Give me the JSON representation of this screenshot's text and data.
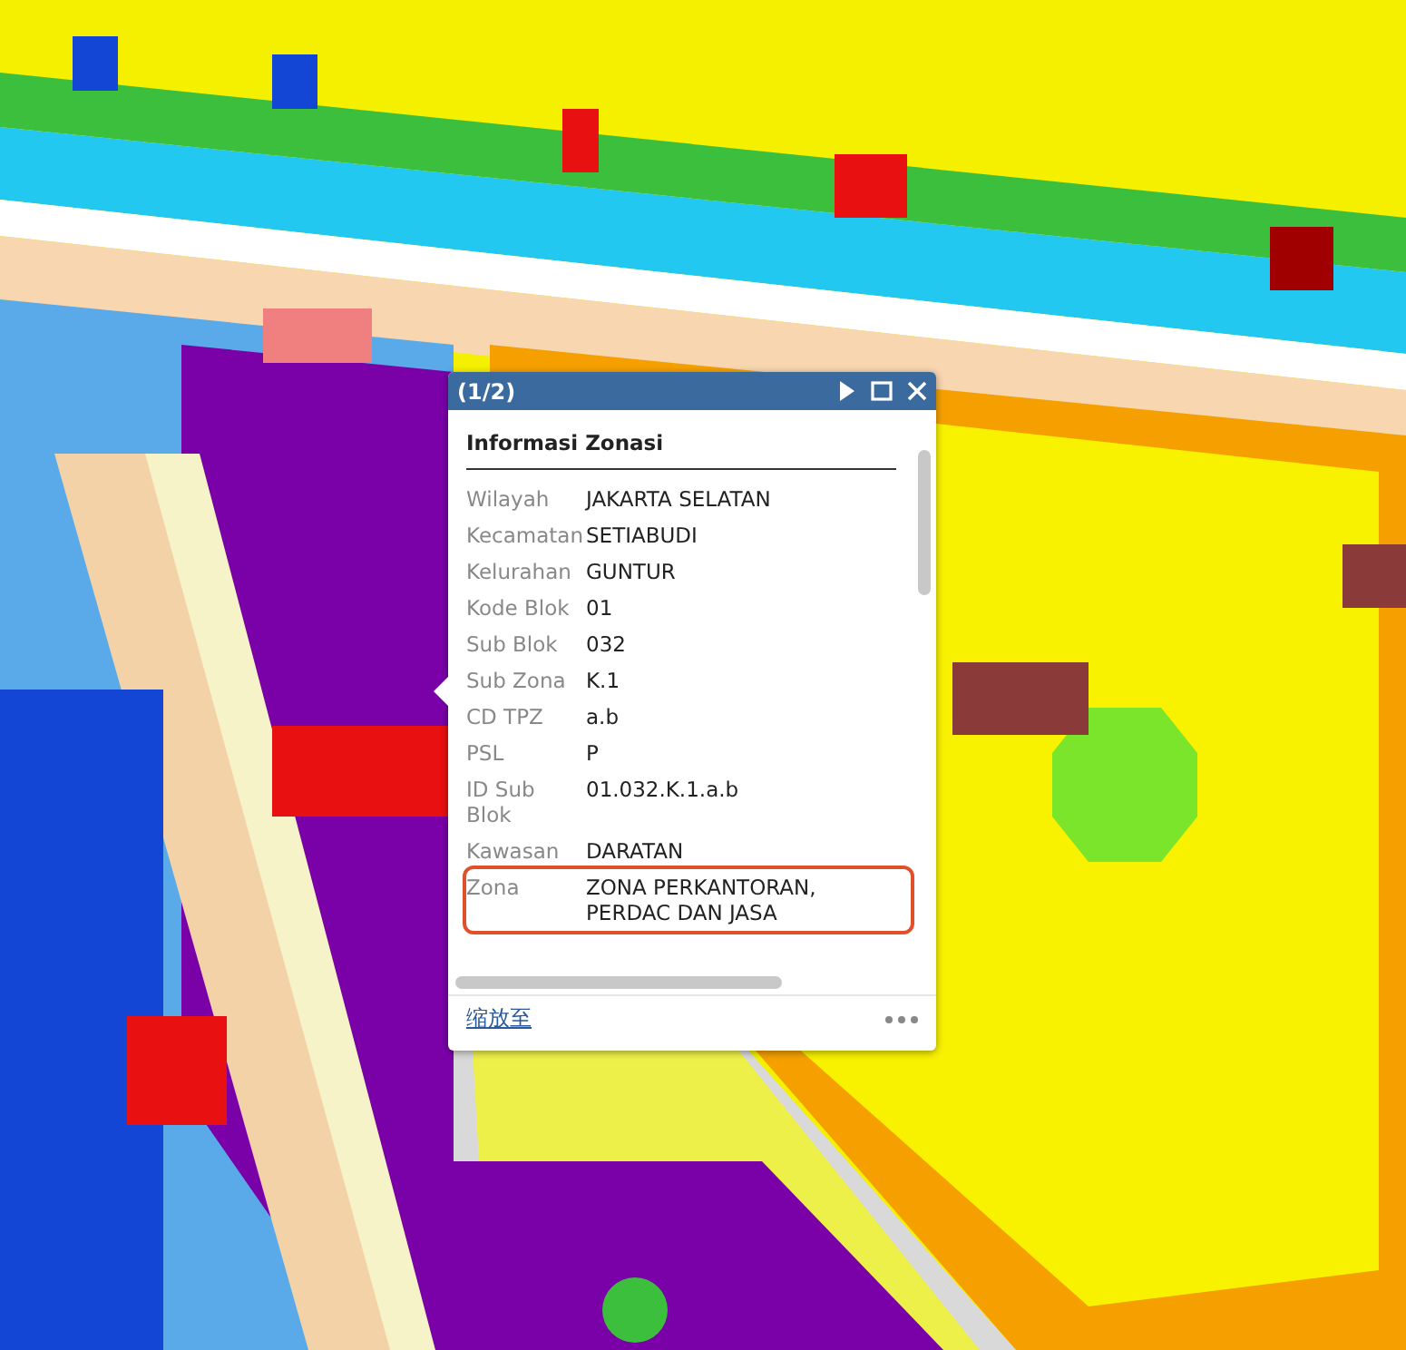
{
  "popup": {
    "counter": "(1/2)",
    "title": "Informasi Zonasi",
    "rows": [
      {
        "label": "Wilayah",
        "value": "JAKARTA SELATAN",
        "highlighted": false
      },
      {
        "label": "Kecamatan",
        "value": "SETIABUDI",
        "highlighted": false
      },
      {
        "label": "Kelurahan",
        "value": "GUNTUR",
        "highlighted": false
      },
      {
        "label": "Kode Blok",
        "value": "01",
        "highlighted": false
      },
      {
        "label": "Sub Blok",
        "value": "032",
        "highlighted": false
      },
      {
        "label": "Sub Zona",
        "value": "K.1",
        "highlighted": false
      },
      {
        "label": "CD TPZ",
        "value": "a.b",
        "highlighted": false
      },
      {
        "label": "PSL",
        "value": "P",
        "highlighted": false
      },
      {
        "label": "ID Sub Blok",
        "value": "01.032.K.1.a.b",
        "highlighted": false
      },
      {
        "label": "Kawasan",
        "value": "DARATAN",
        "highlighted": false
      },
      {
        "label": "Zona",
        "value": "ZONA PERKANTORAN, PERDAC DAN JASA",
        "highlighted": true
      }
    ],
    "zoom_link": "缩放至"
  }
}
